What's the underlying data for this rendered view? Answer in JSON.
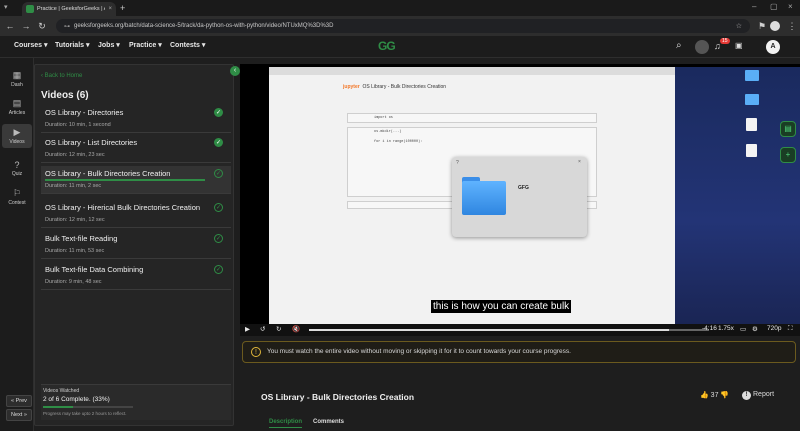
{
  "browser": {
    "tab_title": "Practice | GeeksforGeeks | A co",
    "url": "geeksforgeeks.org/batch/data-science-5/track/da-python-os-with-python/video/NTUxMQ%3D%3D"
  },
  "site": {
    "logo": "GG",
    "menus": [
      "Courses",
      "Tutorials",
      "Jobs",
      "Practice",
      "Contests"
    ],
    "notification_count": "15",
    "avatar_letter": "A"
  },
  "rail": {
    "items": [
      "Dash",
      "Articles",
      "Videos",
      "Quiz",
      "Contest"
    ]
  },
  "panel": {
    "back_label": "Back to Home",
    "heading": "Videos (6)",
    "videos": [
      {
        "title": "OS Library - Directories",
        "duration": "Duration: 10 min, 1 second"
      },
      {
        "title": "OS Library - List Directories",
        "duration": "Duration: 12 min, 23 sec"
      },
      {
        "title": "OS Library - Bulk Directories Creation",
        "duration": "Duration: 11 min, 2 sec"
      },
      {
        "title": "OS Library - Hirerical Bulk Directories Creation",
        "duration": "Duration: 12 min, 12 sec"
      },
      {
        "title": "Bulk Text-file Reading",
        "duration": "Duration: 11 min, 53 sec"
      },
      {
        "title": "Bulk Text-file Data Combining",
        "duration": "Duration: 9 min, 48 sec"
      }
    ],
    "watched_label": "Videos Watched",
    "watched_summary": "2 of 6 Complete. (33%)",
    "watched_note": "Progress may take upto 2 hours to reflect.",
    "prev_label": "« Prev",
    "next_label": "Next »"
  },
  "player": {
    "jupyter_title": "OS Library - Bulk Directories Creation",
    "folder_name": "GFG",
    "subtitle": "this is how you can create bulk",
    "time": "-4:16",
    "speed": "1.75x",
    "quality": "720p"
  },
  "notice": "You must watch the entire video without moving or skipping it for it to count towards your course progress.",
  "course": {
    "title": "OS Library - Bulk Directories Creation",
    "likes": "37",
    "report_label": "Report",
    "tabs": [
      "Description",
      "Comments"
    ]
  }
}
